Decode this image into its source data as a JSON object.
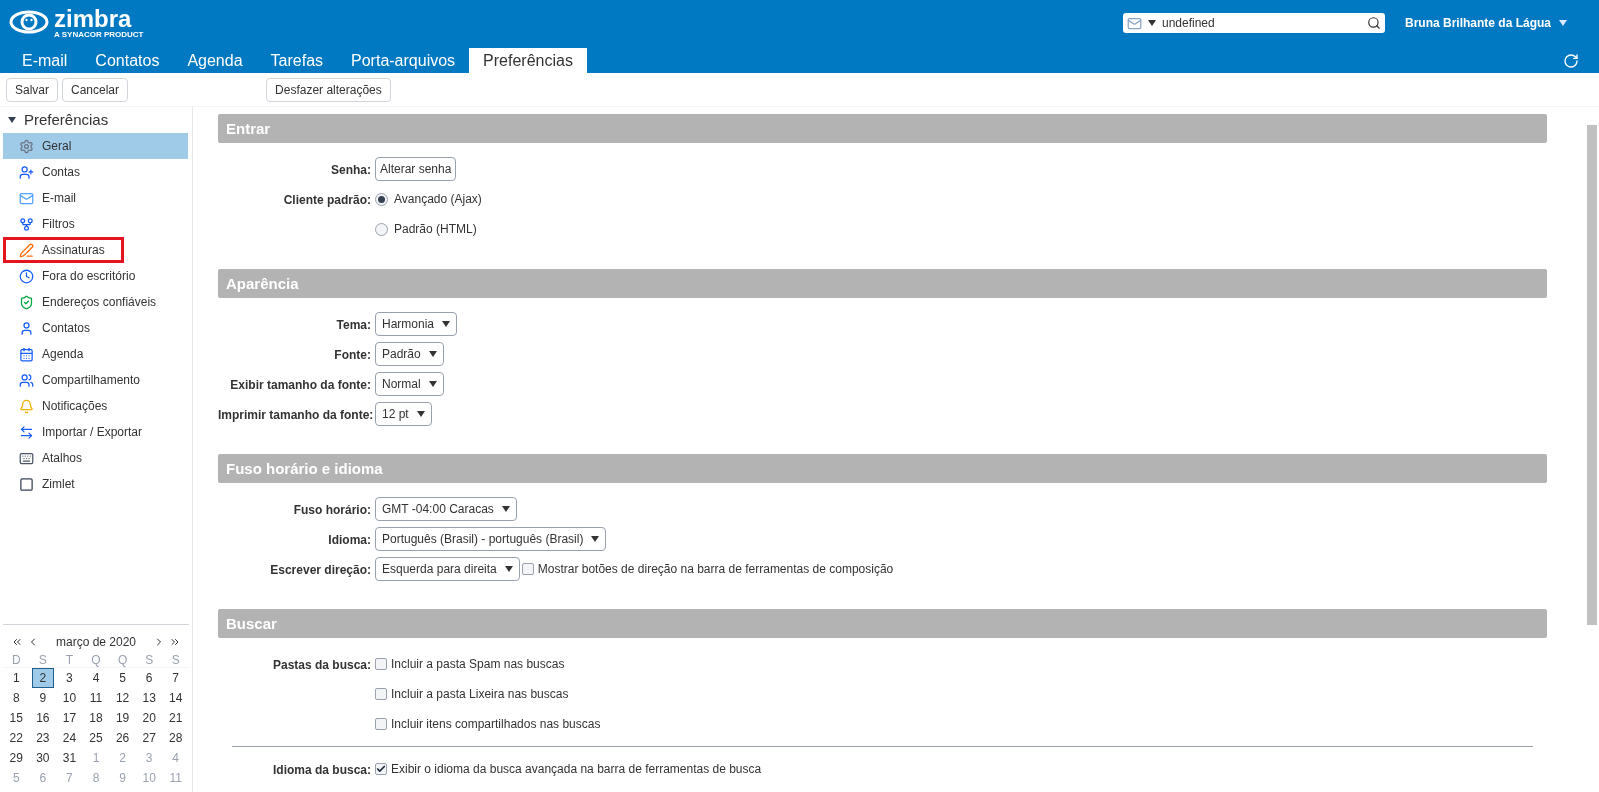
{
  "header": {
    "logo": {
      "name": "zimbra",
      "tagline": "A SYNACOR PRODUCT"
    },
    "search": {
      "value": "undefined"
    },
    "user": "Bruna Brilhante da Lágua"
  },
  "tabs": [
    {
      "label": "E-mail",
      "selected": false
    },
    {
      "label": "Contatos",
      "selected": false
    },
    {
      "label": "Agenda",
      "selected": false
    },
    {
      "label": "Tarefas",
      "selected": false
    },
    {
      "label": "Porta-arquivos",
      "selected": false
    },
    {
      "label": "Preferências",
      "selected": true
    }
  ],
  "toolbar": {
    "left": [
      "Salvar",
      "Cancelar"
    ],
    "right": [
      "Desfazer alterações"
    ]
  },
  "sidebar": {
    "title": "Preferências",
    "expanded": true,
    "items": [
      {
        "label": "Geral",
        "selected": true,
        "outlined": false
      },
      {
        "label": "Contas",
        "selected": false,
        "outlined": false
      },
      {
        "label": "E-mail",
        "selected": false,
        "outlined": false
      },
      {
        "label": "Filtros",
        "selected": false,
        "outlined": false
      },
      {
        "label": "Assinaturas",
        "selected": false,
        "outlined": true
      },
      {
        "label": "Fora do escritório",
        "selected": false,
        "outlined": false
      },
      {
        "label": "Endereços confiáveis",
        "selected": false,
        "outlined": false
      },
      {
        "label": "Contatos",
        "selected": false,
        "outlined": false
      },
      {
        "label": "Agenda",
        "selected": false,
        "outlined": false
      },
      {
        "label": "Compartilhamento",
        "selected": false,
        "outlined": false
      },
      {
        "label": "Notificações",
        "selected": false,
        "outlined": false
      },
      {
        "label": "Importar / Exportar",
        "selected": false,
        "outlined": false
      },
      {
        "label": "Atalhos",
        "selected": false,
        "outlined": false
      },
      {
        "label": "Zimlet",
        "selected": false,
        "outlined": false
      }
    ]
  },
  "calendar": {
    "month": "março de 2020",
    "weekdays": [
      "D",
      "S",
      "T",
      "Q",
      "Q",
      "S",
      "S"
    ],
    "weeks": [
      [
        {
          "day": "1",
          "muted": false,
          "selected": false
        },
        {
          "day": "2",
          "muted": false,
          "selected": true
        },
        {
          "day": "3",
          "muted": false,
          "selected": false
        },
        {
          "day": "4",
          "muted": false,
          "selected": false
        },
        {
          "day": "5",
          "muted": false,
          "selected": false
        },
        {
          "day": "6",
          "muted": false,
          "selected": false
        },
        {
          "day": "7",
          "muted": false,
          "selected": false
        }
      ],
      [
        {
          "day": "8",
          "muted": false,
          "selected": false
        },
        {
          "day": "9",
          "muted": false,
          "selected": false
        },
        {
          "day": "10",
          "muted": false,
          "selected": false
        },
        {
          "day": "11",
          "muted": false,
          "selected": false
        },
        {
          "day": "12",
          "muted": false,
          "selected": false
        },
        {
          "day": "13",
          "muted": false,
          "selected": false
        },
        {
          "day": "14",
          "muted": false,
          "selected": false
        }
      ],
      [
        {
          "day": "15",
          "muted": false,
          "selected": false
        },
        {
          "day": "16",
          "muted": false,
          "selected": false
        },
        {
          "day": "17",
          "muted": false,
          "selected": false
        },
        {
          "day": "18",
          "muted": false,
          "selected": false
        },
        {
          "day": "19",
          "muted": false,
          "selected": false
        },
        {
          "day": "20",
          "muted": false,
          "selected": false
        },
        {
          "day": "21",
          "muted": false,
          "selected": false
        }
      ],
      [
        {
          "day": "22",
          "muted": false,
          "selected": false
        },
        {
          "day": "23",
          "muted": false,
          "selected": false
        },
        {
          "day": "24",
          "muted": false,
          "selected": false
        },
        {
          "day": "25",
          "muted": false,
          "selected": false
        },
        {
          "day": "26",
          "muted": false,
          "selected": false
        },
        {
          "day": "27",
          "muted": false,
          "selected": false
        },
        {
          "day": "28",
          "muted": false,
          "selected": false
        }
      ],
      [
        {
          "day": "29",
          "muted": false,
          "selected": false
        },
        {
          "day": "30",
          "muted": false,
          "selected": false
        },
        {
          "day": "31",
          "muted": false,
          "selected": false
        },
        {
          "day": "1",
          "muted": true,
          "selected": false
        },
        {
          "day": "2",
          "muted": true,
          "selected": false
        },
        {
          "day": "3",
          "muted": true,
          "selected": false
        },
        {
          "day": "4",
          "muted": true,
          "selected": false
        }
      ],
      [
        {
          "day": "5",
          "muted": true,
          "selected": false
        },
        {
          "day": "6",
          "muted": true,
          "selected": false
        },
        {
          "day": "7",
          "muted": true,
          "selected": false
        },
        {
          "day": "8",
          "muted": true,
          "selected": false
        },
        {
          "day": "9",
          "muted": true,
          "selected": false
        },
        {
          "day": "10",
          "muted": true,
          "selected": false
        },
        {
          "day": "11",
          "muted": true,
          "selected": false
        }
      ]
    ]
  },
  "sections": [
    {
      "title": "Entrar",
      "rows": [
        {
          "label": "Senha:",
          "controls": [
            {
              "kind": "button",
              "text": "Alterar senha"
            }
          ]
        },
        {
          "label": "Cliente padrão:",
          "controls": [
            {
              "kind": "radio",
              "text": "Avançado (Ajax)",
              "selected": true
            }
          ]
        },
        {
          "controls": [
            {
              "kind": "radio",
              "text": "Padrão (HTML)",
              "selected": false
            }
          ]
        }
      ]
    },
    {
      "title": "Aparência",
      "rows": [
        {
          "label": "Tema:",
          "controls": [
            {
              "kind": "select",
              "text": "Harmonia"
            }
          ]
        },
        {
          "label": "Fonte:",
          "controls": [
            {
              "kind": "select",
              "text": "Padrão"
            }
          ]
        },
        {
          "label": "Exibir tamanho da fonte:",
          "controls": [
            {
              "kind": "select",
              "text": "Normal"
            }
          ]
        },
        {
          "label": "Imprimir tamanho da fonte:",
          "controls": [
            {
              "kind": "select",
              "text": "12 pt"
            }
          ]
        }
      ]
    },
    {
      "title": "Fuso horário e idioma",
      "rows": [
        {
          "label": "Fuso horário:",
          "controls": [
            {
              "kind": "select",
              "text": "GMT -04:00 Caracas"
            }
          ]
        },
        {
          "label": "Idioma:",
          "controls": [
            {
              "kind": "select",
              "text": "Português (Brasil) - português (Brasil)"
            }
          ]
        },
        {
          "label": "Escrever direção:",
          "controls": [
            {
              "kind": "select",
              "text": "Esquerda para direita"
            },
            {
              "kind": "checkbox",
              "text": "Mostrar botões de direção na barra de ferramentas de composição",
              "checked": false
            }
          ]
        }
      ]
    },
    {
      "title": "Buscar",
      "rows": [
        {
          "label": "Pastas da busca:",
          "controls": [
            {
              "kind": "checkbox",
              "text": "Incluir a pasta Spam nas buscas",
              "checked": false
            }
          ]
        },
        {
          "controls": [
            {
              "kind": "checkbox",
              "text": "Incluir a pasta Lixeira nas buscas",
              "checked": false
            }
          ]
        },
        {
          "controls": [
            {
              "kind": "checkbox",
              "text": "Incluir itens compartilhados nas buscas",
              "checked": false
            }
          ]
        },
        {
          "kind": "divider"
        },
        {
          "label": "Idioma da busca:",
          "controls": [
            {
              "kind": "checkbox",
              "text": "Exibir o idioma da busca avançada na barra de ferramentas de busca",
              "checked": true
            }
          ]
        }
      ]
    }
  ]
}
